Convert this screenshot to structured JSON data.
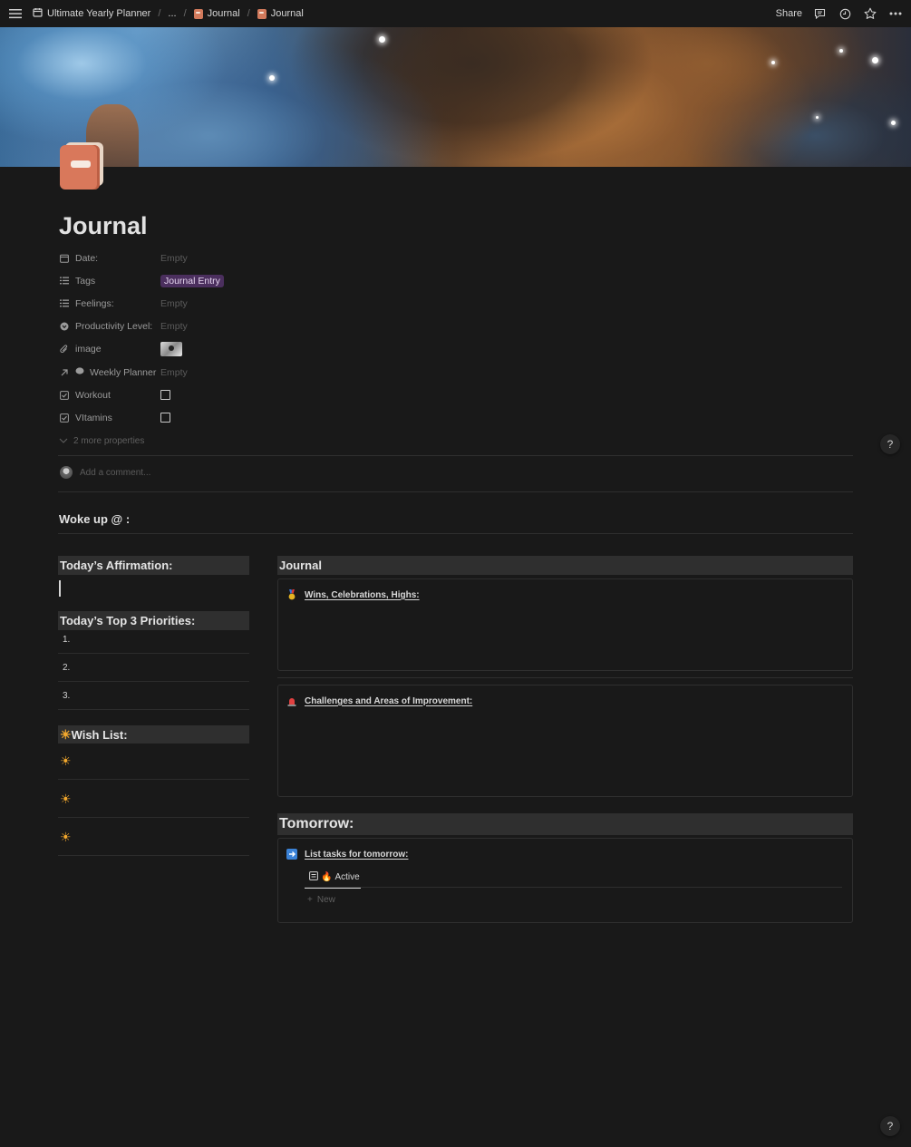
{
  "breadcrumb": {
    "workspace": "Ultimate Yearly Planner",
    "ellipsis": "...",
    "parent": "Journal",
    "current": "Journal"
  },
  "topbar": {
    "share_label": "Share"
  },
  "page": {
    "title": "Journal"
  },
  "properties": {
    "date": {
      "label": "Date:",
      "value": "Empty"
    },
    "tags": {
      "label": "Tags",
      "value": "Journal Entry"
    },
    "feelings": {
      "label": "Feelings:",
      "value": "Empty"
    },
    "productivity": {
      "label": "Productivity Level:",
      "value": "Empty"
    },
    "image": {
      "label": "image"
    },
    "weekly": {
      "label": "Weekly Planner",
      "value": "Empty"
    },
    "workout": {
      "label": "Workout",
      "checked": false
    },
    "vitamins": {
      "label": "VItamins",
      "checked": false
    },
    "more": "2 more properties"
  },
  "comment": {
    "placeholder": "Add a comment..."
  },
  "woke_up": "Woke up @ :",
  "left": {
    "affirmation_heading": "Today’s Affirmation:",
    "priorities_heading": "Today’s Top 3 Priorities:",
    "priorities": [
      "1.",
      "2.",
      "3."
    ],
    "wishlist_heading": "Wish List:"
  },
  "journal": {
    "heading": "Journal",
    "wins": "Wins, Celebrations, Highs:",
    "challenges": "Challenges and Areas of Improvement:"
  },
  "tomorrow": {
    "heading": "Tomorrow:",
    "tasks": "List tasks for tomorrow:",
    "tab": "Active",
    "new": "New"
  },
  "help": "?",
  "colors": {
    "background": "#191919",
    "tag_bg": "#4b2f5e",
    "heading_bar": "#2f2f2f",
    "icon_accent": "#d9785b"
  }
}
